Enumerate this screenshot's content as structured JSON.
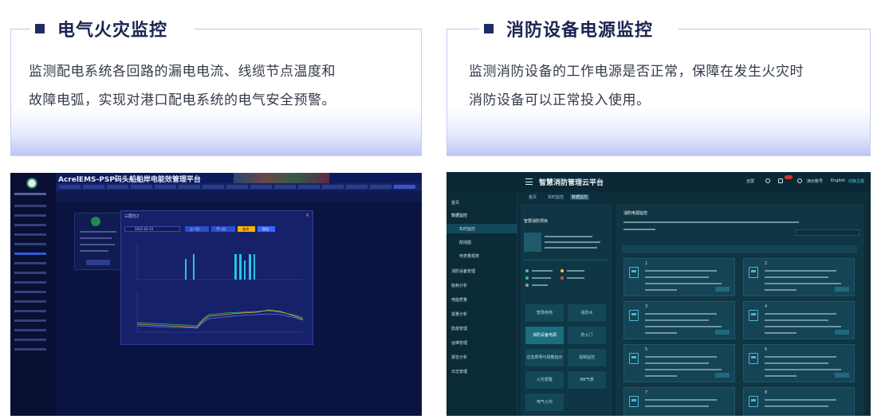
{
  "cards": [
    {
      "title": "电气火灾监控",
      "description_line1": "监测配电系统各回路的漏电电流、线缆节点温度和",
      "description_line2": "故障电弧，实现对港口配电系统的电气安全预警。"
    },
    {
      "title": "消防设备电源监控",
      "description_line1": "监测消防设备的工作电源是否正常，保障在发生火灾时",
      "description_line2": "消防设备可以正常投入使用。"
    }
  ],
  "screenshot1": {
    "app_title": "AcrelEMS-PSP码头船舶岸电能效管理平台",
    "modal_title": "三层灯2",
    "date_value": "2022-02-15",
    "prev_label": "上一日",
    "next_label": "下一日",
    "query_label": "查询",
    "export_label": "导出",
    "colors": {
      "bg": "#0b1440",
      "modal": "#17216a",
      "accent": "#f6b500",
      "series": [
        "#f5a623",
        "#27c46b",
        "#5b7cff"
      ]
    }
  },
  "screenshot2": {
    "app_title": "智慧消防管理云平台",
    "top_right": [
      "全屏",
      "演示账号",
      "English",
      "切换主题"
    ],
    "tabs": [
      "首页",
      "实时监控",
      "数据监控"
    ],
    "sidebar": [
      "首页",
      "数据监控",
      "实时监控",
      "配线图",
      "电表量报表",
      "消防设备管理",
      "能耗分析",
      "电能质量",
      "需量分析",
      "隐患管理",
      "运维管理",
      "报告分析",
      "日志管理"
    ],
    "project_name": "智慧消防项目",
    "tiles": [
      "智慧用电",
      "消防水",
      "消防设备电源",
      "防火门",
      "应急照明与疏散指示",
      "视频监控",
      "火灾报警",
      "NB气感",
      "电气火灾"
    ],
    "section_title": "消防电源监控",
    "device_ids": [
      "1",
      "2",
      "3",
      "4",
      "5",
      "6",
      "7",
      "8"
    ],
    "colors": {
      "bg": "#0d2c3a",
      "panel": "#103543",
      "card": "#154455",
      "accent": "#4fb6d6",
      "online": "#2ecc71"
    }
  }
}
